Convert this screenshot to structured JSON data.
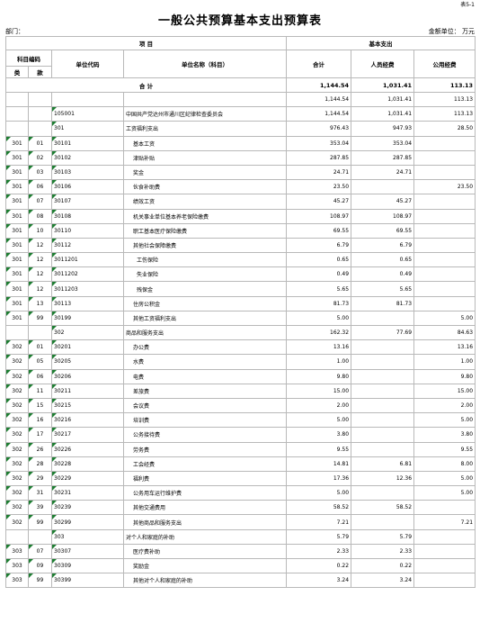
{
  "page": {
    "tag": "表5-1",
    "title": "一般公共预算基本支出预算表",
    "dept_label": "部门：",
    "unit_label": "金额单位：  万元"
  },
  "header": {
    "item": "项                    目",
    "basic_expense": "基本支出",
    "subject_code": "科目编码",
    "class": "类",
    "section": "款",
    "unit_code": "单位代码",
    "unit_name": "单位名称（科目）",
    "total": "合计",
    "personnel": "人员经费",
    "public": "公用经费"
  },
  "total_row": {
    "label": "合            计",
    "total": "1,144.54",
    "personnel": "1,031.41",
    "public": "113.13"
  },
  "rows": [
    {
      "cls": "",
      "sec": "",
      "code": "",
      "name": "",
      "total": "1,144.54",
      "pers": "1,031.41",
      "pub": "113.13",
      "ind": 0,
      "flag": false
    },
    {
      "cls": "",
      "sec": "",
      "code": "105001",
      "name": "中国共产党达州市通川区纪律检查委员会",
      "total": "1,144.54",
      "pers": "1,031.41",
      "pub": "113.13",
      "ind": 0,
      "flag": true
    },
    {
      "cls": "",
      "sec": "",
      "code": "301",
      "name": "工资福利支出",
      "total": "976.43",
      "pers": "947.93",
      "pub": "28.50",
      "ind": 0,
      "flag": true
    },
    {
      "cls": "301",
      "sec": "01",
      "code": "30101",
      "name": "基本工资",
      "total": "353.04",
      "pers": "353.04",
      "pub": "",
      "ind": 1,
      "flag": true
    },
    {
      "cls": "301",
      "sec": "02",
      "code": "30102",
      "name": "津贴补贴",
      "total": "287.85",
      "pers": "287.85",
      "pub": "",
      "ind": 1,
      "flag": true
    },
    {
      "cls": "301",
      "sec": "03",
      "code": "30103",
      "name": "奖金",
      "total": "24.71",
      "pers": "24.71",
      "pub": "",
      "ind": 1,
      "flag": true
    },
    {
      "cls": "301",
      "sec": "06",
      "code": "30106",
      "name": "伙食补助费",
      "total": "23.50",
      "pers": "",
      "pub": "23.50",
      "ind": 1,
      "flag": true
    },
    {
      "cls": "301",
      "sec": "07",
      "code": "30107",
      "name": "绩效工资",
      "total": "45.27",
      "pers": "45.27",
      "pub": "",
      "ind": 1,
      "flag": true
    },
    {
      "cls": "301",
      "sec": "08",
      "code": "30108",
      "name": "机关事业单位基本养老保险缴费",
      "total": "108.97",
      "pers": "108.97",
      "pub": "",
      "ind": 1,
      "flag": true
    },
    {
      "cls": "301",
      "sec": "10",
      "code": "30110",
      "name": "职工基本医疗保险缴费",
      "total": "69.55",
      "pers": "69.55",
      "pub": "",
      "ind": 1,
      "flag": true
    },
    {
      "cls": "301",
      "sec": "12",
      "code": "30112",
      "name": "其他社会保障缴费",
      "total": "6.79",
      "pers": "6.79",
      "pub": "",
      "ind": 1,
      "flag": true
    },
    {
      "cls": "301",
      "sec": "12",
      "code": "3011201",
      "name": "工伤保险",
      "total": "0.65",
      "pers": "0.65",
      "pub": "",
      "ind": 2,
      "flag": true
    },
    {
      "cls": "301",
      "sec": "12",
      "code": "3011202",
      "name": "失业保险",
      "total": "0.49",
      "pers": "0.49",
      "pub": "",
      "ind": 2,
      "flag": true
    },
    {
      "cls": "301",
      "sec": "12",
      "code": "3011203",
      "name": "残保金",
      "total": "5.65",
      "pers": "5.65",
      "pub": "",
      "ind": 2,
      "flag": true
    },
    {
      "cls": "301",
      "sec": "13",
      "code": "30113",
      "name": "住房公积金",
      "total": "81.73",
      "pers": "81.73",
      "pub": "",
      "ind": 1,
      "flag": true
    },
    {
      "cls": "301",
      "sec": "99",
      "code": "30199",
      "name": "其他工资福利支出",
      "total": "5.00",
      "pers": "",
      "pub": "5.00",
      "ind": 1,
      "flag": true
    },
    {
      "cls": "",
      "sec": "",
      "code": "302",
      "name": "商品和服务支出",
      "total": "162.32",
      "pers": "77.69",
      "pub": "84.63",
      "ind": 0,
      "flag": true
    },
    {
      "cls": "302",
      "sec": "01",
      "code": "30201",
      "name": "办公费",
      "total": "13.16",
      "pers": "",
      "pub": "13.16",
      "ind": 1,
      "flag": true
    },
    {
      "cls": "302",
      "sec": "05",
      "code": "30205",
      "name": "水费",
      "total": "1.00",
      "pers": "",
      "pub": "1.00",
      "ind": 1,
      "flag": true
    },
    {
      "cls": "302",
      "sec": "06",
      "code": "30206",
      "name": "电费",
      "total": "9.80",
      "pers": "",
      "pub": "9.80",
      "ind": 1,
      "flag": true
    },
    {
      "cls": "302",
      "sec": "11",
      "code": "30211",
      "name": "差旅费",
      "total": "15.00",
      "pers": "",
      "pub": "15.00",
      "ind": 1,
      "flag": true
    },
    {
      "cls": "302",
      "sec": "15",
      "code": "30215",
      "name": "会议费",
      "total": "2.00",
      "pers": "",
      "pub": "2.00",
      "ind": 1,
      "flag": true
    },
    {
      "cls": "302",
      "sec": "16",
      "code": "30216",
      "name": "培训费",
      "total": "5.00",
      "pers": "",
      "pub": "5.00",
      "ind": 1,
      "flag": true
    },
    {
      "cls": "302",
      "sec": "17",
      "code": "30217",
      "name": "公务接待费",
      "total": "3.80",
      "pers": "",
      "pub": "3.80",
      "ind": 1,
      "flag": true
    },
    {
      "cls": "302",
      "sec": "26",
      "code": "30226",
      "name": "劳务费",
      "total": "9.55",
      "pers": "",
      "pub": "9.55",
      "ind": 1,
      "flag": true
    },
    {
      "cls": "302",
      "sec": "28",
      "code": "30228",
      "name": "工会经费",
      "total": "14.81",
      "pers": "6.81",
      "pub": "8.00",
      "ind": 1,
      "flag": true
    },
    {
      "cls": "302",
      "sec": "29",
      "code": "30229",
      "name": "福利费",
      "total": "17.36",
      "pers": "12.36",
      "pub": "5.00",
      "ind": 1,
      "flag": true
    },
    {
      "cls": "302",
      "sec": "31",
      "code": "30231",
      "name": "公务用车运行维护费",
      "total": "5.00",
      "pers": "",
      "pub": "5.00",
      "ind": 1,
      "flag": true
    },
    {
      "cls": "302",
      "sec": "39",
      "code": "30239",
      "name": "其他交通费用",
      "total": "58.52",
      "pers": "58.52",
      "pub": "",
      "ind": 1,
      "flag": true
    },
    {
      "cls": "302",
      "sec": "99",
      "code": "30299",
      "name": "其他商品和服务支出",
      "total": "7.21",
      "pers": "",
      "pub": "7.21",
      "ind": 1,
      "flag": true
    },
    {
      "cls": "",
      "sec": "",
      "code": "303",
      "name": "对个人和家庭的补助",
      "total": "5.79",
      "pers": "5.79",
      "pub": "",
      "ind": 0,
      "flag": true
    },
    {
      "cls": "303",
      "sec": "07",
      "code": "30307",
      "name": "医疗费补助",
      "total": "2.33",
      "pers": "2.33",
      "pub": "",
      "ind": 1,
      "flag": true
    },
    {
      "cls": "303",
      "sec": "09",
      "code": "30309",
      "name": "奖励金",
      "total": "0.22",
      "pers": "0.22",
      "pub": "",
      "ind": 1,
      "flag": true
    },
    {
      "cls": "303",
      "sec": "99",
      "code": "30399",
      "name": "其他对个人和家庭的补助",
      "total": "3.24",
      "pers": "3.24",
      "pub": "",
      "ind": 1,
      "flag": true
    }
  ]
}
